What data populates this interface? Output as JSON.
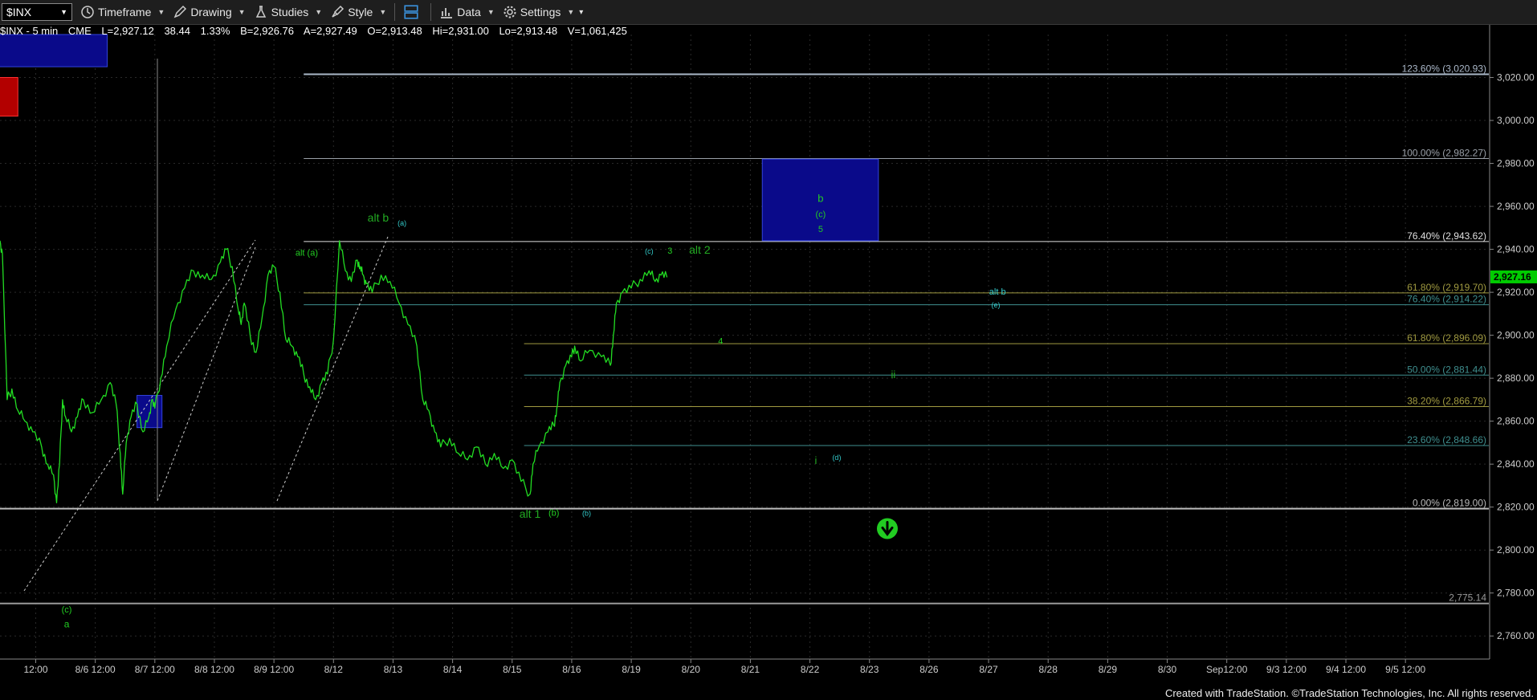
{
  "toolbar": {
    "symbol": "$INX",
    "timeframe": "Timeframe",
    "drawing": "Drawing",
    "studies": "Studies",
    "style": "Style",
    "data": "Data",
    "settings": "Settings"
  },
  "infobar": {
    "symbol_label": "$INX - 5 min",
    "exchange": "CME",
    "last": "L=2,927.12",
    "change": "38.44",
    "change_pct": "1.33%",
    "bid": "B=2,926.76",
    "ask": "A=2,927.49",
    "open": "O=2,913.48",
    "high": "Hi=2,931.00",
    "low": "Lo=2,913.48",
    "volume": "V=1,061,425"
  },
  "footer": "Created with TradeStation. ©TradeStation Technologies, Inc. All rights reserved.",
  "colors": {
    "price_line": "#22dd22",
    "wave_label_green": "#22cc22",
    "wave_label_cyan": "#33cccc",
    "box_fill": "#0a0a8a",
    "box_red": "#b30000",
    "axis_text": "#cccccc",
    "last_price_bg": "#00cc00"
  },
  "chart_data": {
    "type": "line",
    "title": "",
    "ylabel": "",
    "ylim": [
      2750,
      3040
    ],
    "yticks": [
      2760,
      2780,
      2800,
      2820,
      2840,
      2860,
      2880,
      2900,
      2920,
      2940,
      2960,
      2980,
      3000,
      3020
    ],
    "ytick_labels": [
      "2,760.00",
      "2,780.00",
      "2,800.00",
      "2,820.00",
      "2,840.00",
      "2,860.00",
      "2,880.00",
      "2,900.00",
      "2,920.00",
      "2,940.00",
      "2,960.00",
      "2,980.00",
      "3,000.00",
      "3,020.00"
    ],
    "xlim": [
      0,
      25
    ],
    "xticks": [
      0.6,
      1.6,
      2.6,
      3.6,
      4.6,
      5.6,
      6.6,
      7.6,
      8.6,
      9.6,
      10.6,
      11.6,
      12.6,
      13.6,
      14.6,
      15.6,
      16.6,
      17.6,
      18.6,
      19.6,
      20.6,
      21.6,
      22.6,
      23.6
    ],
    "xtick_labels": [
      "12:00",
      "8/6 12:00",
      "8/7 12:00",
      "8/8 12:00",
      "8/9 12:00",
      "8/12",
      "8/13",
      "8/14",
      "8/15",
      "8/16",
      "8/19",
      "8/20",
      "8/21",
      "8/22",
      "8/23",
      "8/26",
      "8/27",
      "8/28",
      "8/29",
      "8/30",
      "Sep12:00",
      "9/3 12:00",
      "9/4 12:00",
      "9/5 12:00"
    ],
    "grid": true,
    "last_price_label": "2,927.16",
    "last_price": 2927.16,
    "series": [
      {
        "x": [
          0.0,
          0.04,
          0.12,
          0.2,
          0.3,
          0.42,
          0.55,
          0.7,
          0.8,
          0.9,
          0.95,
          1.0,
          1.05,
          1.1,
          1.2,
          1.3,
          1.4,
          1.55,
          1.7,
          1.85,
          1.95,
          2.02,
          2.06,
          2.12,
          2.2,
          2.3,
          2.4,
          2.5,
          2.55,
          2.6,
          2.7,
          2.8,
          2.95,
          3.1,
          3.25,
          3.4,
          3.55,
          3.7,
          3.8,
          3.9,
          4.0,
          4.05,
          4.1,
          4.2,
          4.3,
          4.4,
          4.5,
          4.6,
          4.7,
          4.8,
          4.9,
          5.0,
          5.1,
          5.2,
          5.3,
          5.4,
          5.5,
          5.6,
          5.7,
          5.8,
          5.9,
          6.0,
          6.05,
          6.1,
          6.15,
          6.25,
          6.4,
          6.55,
          6.7,
          6.85,
          7.0,
          7.1,
          7.2,
          7.3,
          7.4,
          7.55,
          7.7,
          7.85,
          8.0,
          8.15,
          8.3,
          8.45,
          8.6,
          8.75,
          8.9,
          8.95,
          9.05,
          9.2,
          9.3,
          9.35,
          9.4,
          9.5,
          9.6,
          9.65,
          9.75,
          9.9,
          10.1,
          10.25,
          10.3,
          10.35,
          10.45,
          10.6,
          10.75,
          10.9,
          11.0,
          11.1,
          11.2
        ],
        "y": [
          2944,
          2938,
          2870,
          2875,
          2865,
          2860,
          2855,
          2848,
          2840,
          2835,
          2822,
          2840,
          2870,
          2862,
          2855,
          2862,
          2870,
          2864,
          2870,
          2878,
          2868,
          2845,
          2826,
          2850,
          2862,
          2868,
          2855,
          2862,
          2870,
          2866,
          2880,
          2895,
          2912,
          2922,
          2930,
          2928,
          2926,
          2934,
          2940,
          2932,
          2912,
          2905,
          2915,
          2900,
          2892,
          2908,
          2928,
          2932,
          2920,
          2898,
          2895,
          2890,
          2882,
          2876,
          2870,
          2878,
          2882,
          2898,
          2944,
          2930,
          2925,
          2935,
          2932,
          2928,
          2924,
          2920,
          2928,
          2925,
          2915,
          2905,
          2895,
          2870,
          2865,
          2855,
          2848,
          2852,
          2845,
          2842,
          2848,
          2840,
          2845,
          2838,
          2842,
          2832,
          2826,
          2840,
          2848,
          2855,
          2858,
          2866,
          2878,
          2886,
          2890,
          2895,
          2888,
          2893,
          2890,
          2886,
          2900,
          2915,
          2920,
          2922,
          2926,
          2930,
          2925,
          2928,
          2927
        ]
      }
    ],
    "fib_levels": [
      {
        "label": "123.60% (3,020.93)",
        "value": 3021.5,
        "color": "#aab7c8",
        "x_start": 5.1
      },
      {
        "label": "100.00% (2,982.27)",
        "value": 2982.27,
        "color": "#9aa0a8",
        "x_start": 5.1
      },
      {
        "label": "76.40% (2,943.62)",
        "value": 2943.62,
        "color": "#e0e0e0",
        "x_start": 5.1
      },
      {
        "label": "61.80% (2,919.70)",
        "value": 2919.7,
        "color": "#a09a40",
        "x_start": 5.1
      },
      {
        "label": "76.40% (2,914.22)",
        "value": 2914.22,
        "color": "#3f8f8f",
        "x_start": 5.1
      },
      {
        "label": "61.80% (2,896.09)",
        "value": 2896.09,
        "color": "#a09a40",
        "x_start": 8.8
      },
      {
        "label": "50.00% (2,881.44)",
        "value": 2881.44,
        "color": "#3f8f8f",
        "x_start": 8.8
      },
      {
        "label": "38.20% (2,866.79)",
        "value": 2866.79,
        "color": "#a09a40",
        "x_start": 8.8
      },
      {
        "label": "23.60% (2,848.66)",
        "value": 2848.66,
        "color": "#3f8f8f",
        "x_start": 8.8
      },
      {
        "label": "0.00% (2,819.00)",
        "value": 2819.3,
        "color": "#bbbbbb",
        "x_start": 0
      },
      {
        "label": "2,775.14",
        "value": 2775.14,
        "color": "#999999",
        "x_start": 0
      }
    ],
    "boxes": [
      {
        "x0": 12.8,
        "x1": 14.75,
        "y0": 2944,
        "y1": 2982,
        "color": "#0a0a8a"
      },
      {
        "x0": -0.1,
        "x1": 1.8,
        "y0": 3025,
        "y1": 3040,
        "color": "#0a0a8a"
      },
      {
        "x0": -0.1,
        "x1": 0.3,
        "y0": 3002,
        "y1": 3020,
        "color": "#b30000"
      },
      {
        "x0": 2.3,
        "x1": 2.72,
        "y0": 2857,
        "y1": 2872,
        "color": "#0a0a8a"
      }
    ],
    "wave_labels": [
      {
        "text": "(c)",
        "x": 1.12,
        "y": 2771,
        "color": "#22cc22",
        "size": 11
      },
      {
        "text": "a",
        "x": 1.12,
        "y": 2764,
        "color": "#22cc22",
        "size": 12
      },
      {
        "text": "alt b",
        "x": 6.35,
        "y": 2953,
        "color": "#22aa22",
        "size": 14
      },
      {
        "text": "(a)",
        "x": 6.75,
        "y": 2951,
        "color": "#33cccc",
        "size": 9
      },
      {
        "text": "alt (a)",
        "x": 5.15,
        "y": 2937,
        "color": "#22cc22",
        "size": 11
      },
      {
        "text": "(c)",
        "x": 10.9,
        "y": 2938,
        "color": "#33cccc",
        "size": 9
      },
      {
        "text": "3",
        "x": 11.25,
        "y": 2938,
        "color": "#22cc22",
        "size": 11
      },
      {
        "text": "alt 2",
        "x": 11.75,
        "y": 2938,
        "color": "#22aa22",
        "size": 14
      },
      {
        "text": "b",
        "x": 13.78,
        "y": 2962,
        "color": "#22cc22",
        "size": 13
      },
      {
        "text": "(c)",
        "x": 13.78,
        "y": 2955,
        "color": "#22cc22",
        "size": 11
      },
      {
        "text": "5",
        "x": 13.78,
        "y": 2948,
        "color": "#22cc22",
        "size": 11
      },
      {
        "text": "4",
        "x": 12.1,
        "y": 2896,
        "color": "#22cc22",
        "size": 11
      },
      {
        "text": "ii",
        "x": 15.0,
        "y": 2880,
        "color": "#22aa22",
        "size": 13
      },
      {
        "text": "i",
        "x": 13.7,
        "y": 2840,
        "color": "#22aa22",
        "size": 13
      },
      {
        "text": "(d)",
        "x": 14.05,
        "y": 2842,
        "color": "#33cccc",
        "size": 9
      },
      {
        "text": "alt b",
        "x": 16.75,
        "y": 2919,
        "color": "#33cccc",
        "size": 11
      },
      {
        "text": "(e)",
        "x": 16.72,
        "y": 2913,
        "color": "#33cccc",
        "size": 9
      },
      {
        "text": "alt 1",
        "x": 8.9,
        "y": 2815,
        "color": "#22aa22",
        "size": 14
      },
      {
        "text": "(b)",
        "x": 9.3,
        "y": 2816,
        "color": "#22cc22",
        "size": 11
      },
      {
        "text": "(b)",
        "x": 9.85,
        "y": 2816,
        "color": "#33cccc",
        "size": 9
      }
    ],
    "arrow": {
      "x": 14.9,
      "y": 2810
    }
  }
}
